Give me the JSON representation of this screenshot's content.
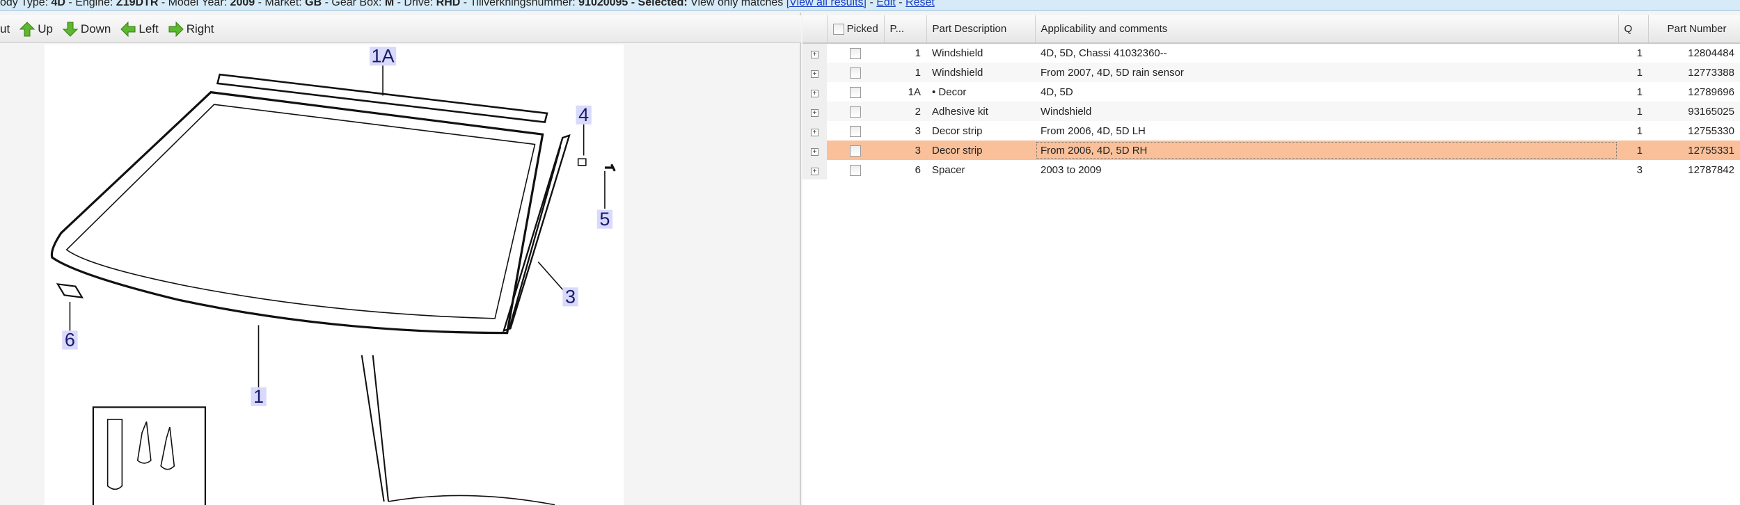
{
  "topbar": {
    "prefix": "ody Type: ",
    "body_type": "4D",
    "engine_label": " - Engine: ",
    "engine": "Z19DTR",
    "year_label": " - Model Year: ",
    "year": "2009",
    "market_label": " - Market: ",
    "market": "GB",
    "gearbox_label": " - Gear Box: ",
    "gearbox": "M",
    "drive_label": " - Drive: ",
    "drive": "RHD",
    "serial_label": " - Tillverkningsnummer: ",
    "serial": "91020095",
    "selected_label": " - Selected:",
    "selected_text": " View only matches ",
    "view_all": "[View all results]",
    "sep1": " - ",
    "edit": "Edit",
    "sep2": " - ",
    "reset": "Reset"
  },
  "toolbar": {
    "cut_label": "ut",
    "up": "Up",
    "down": "Down",
    "left": "Left",
    "right": "Right"
  },
  "diagram": {
    "callouts": [
      "1A",
      "4",
      "5",
      "3",
      "6",
      "1"
    ]
  },
  "table": {
    "headers": {
      "picked": "Picked",
      "pos": "P...",
      "desc": "Part Description",
      "applic": "Applicability and comments",
      "qty": "Q",
      "partno": "Part Number"
    },
    "rows": [
      {
        "pos": "1",
        "desc": "Windshield",
        "applic": "4D, 5D, Chassi 41032360--",
        "qty": "1",
        "partno": "12804484"
      },
      {
        "pos": "1",
        "desc": "Windshield",
        "applic": "From 2007, 4D, 5D rain sensor",
        "qty": "1",
        "partno": "12773388"
      },
      {
        "pos": "1A",
        "desc": "• Decor",
        "applic": "4D, 5D",
        "qty": "1",
        "partno": "12789696"
      },
      {
        "pos": "2",
        "desc": "Adhesive kit",
        "applic": "Windshield",
        "qty": "1",
        "partno": "93165025"
      },
      {
        "pos": "3",
        "desc": "Decor strip",
        "applic": "From 2006, 4D, 5D LH",
        "qty": "1",
        "partno": "12755330"
      },
      {
        "pos": "3",
        "desc": "Decor strip",
        "applic": "From 2006, 4D, 5D RH",
        "qty": "1",
        "partno": "12755331"
      },
      {
        "pos": "6",
        "desc": "Spacer",
        "applic": "2003 to 2009",
        "qty": "3",
        "partno": "12787842"
      }
    ],
    "selected_row": 5,
    "highlight_color": "#f9c09a"
  }
}
